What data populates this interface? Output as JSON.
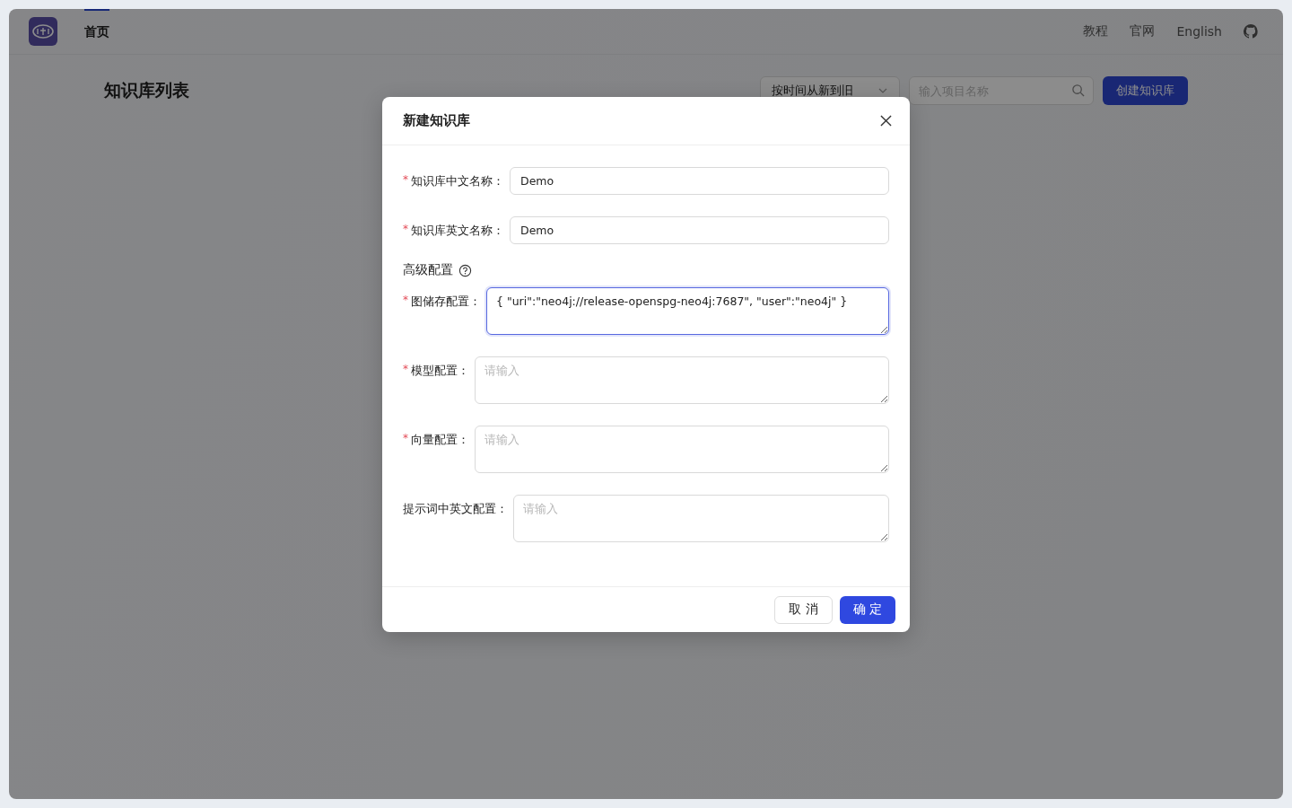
{
  "nav": {
    "tabs": [
      {
        "label": "首页",
        "selected": true
      }
    ],
    "links": [
      "教程",
      "官网",
      "English"
    ]
  },
  "page": {
    "title": "知识库列表",
    "sort_select": {
      "value": "按时间从新到旧"
    },
    "search": {
      "placeholder": "输入项目名称"
    },
    "create_button": "创建知识库"
  },
  "dialog": {
    "title": "新建知识库",
    "fields": [
      {
        "kind": "input",
        "label": "知识库中文名称：",
        "required_mark": "*",
        "value": "Demo",
        "focused": false
      },
      {
        "kind": "input",
        "label": "知识库英文名称：",
        "required_mark": "*",
        "value": "Demo",
        "focused": false
      },
      {
        "kind": "section",
        "label": "高级配置"
      },
      {
        "kind": "textarea",
        "label": "图储存配置：",
        "required_mark": "*",
        "value": "{ \"uri\":\"neo4j://release-openspg-neo4j:7687\", \"user\":\"neo4j\" }",
        "focused": true
      },
      {
        "kind": "textarea",
        "label": "模型配置：",
        "required_mark": "*",
        "placeholder": "请输入",
        "focused": false
      },
      {
        "kind": "textarea",
        "label": "向量配置：",
        "required_mark": "*",
        "placeholder": "请输入",
        "focused": false
      },
      {
        "kind": "textarea",
        "label": "提示词中英文配置：",
        "placeholder": "请输入",
        "focused": false
      }
    ],
    "buttons": [
      {
        "label": "取 消",
        "kind": "default"
      },
      {
        "label": "确 定",
        "kind": "primary"
      }
    ]
  }
}
